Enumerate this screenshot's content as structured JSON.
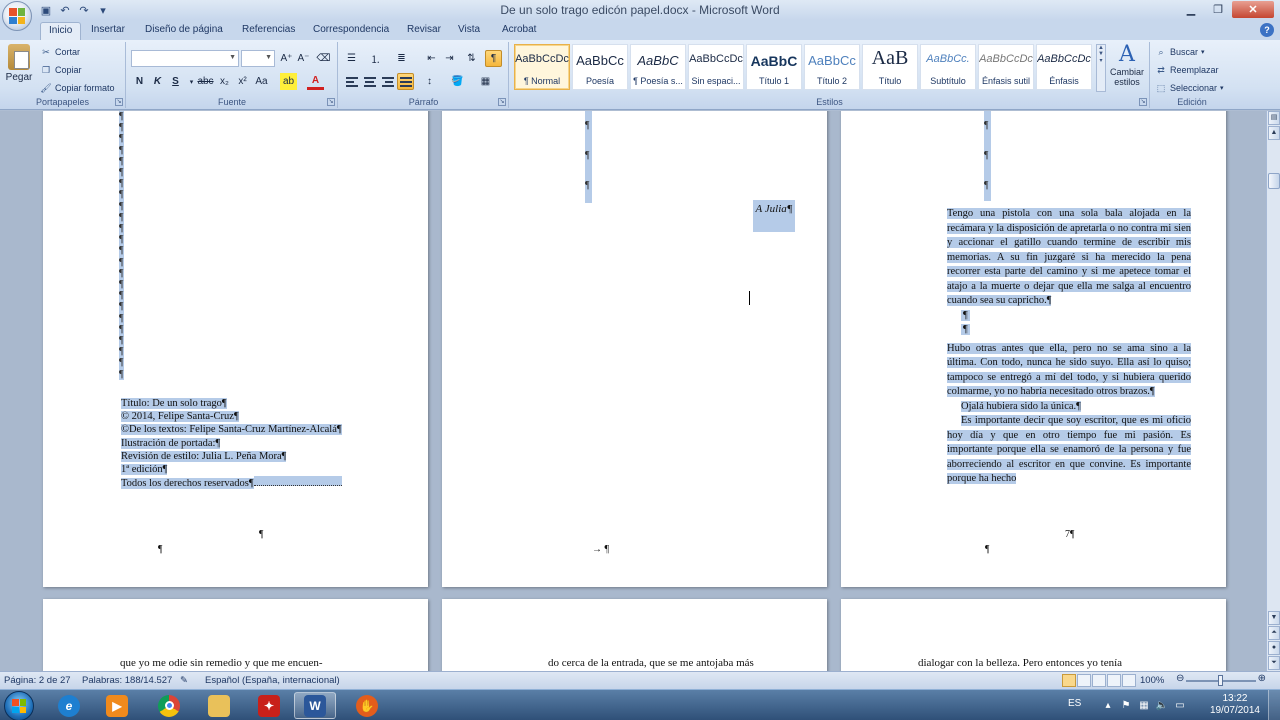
{
  "window": {
    "title": "De un solo trago edicón papel.docx - Microsoft Word"
  },
  "tabs": [
    "Inicio",
    "Insertar",
    "Diseño de página",
    "Referencias",
    "Correspondencia",
    "Revisar",
    "Vista",
    "Acrobat"
  ],
  "ribbon": {
    "clipboard": {
      "label": "Portapapeles",
      "paste": "Pegar",
      "cut": "Cortar",
      "copy": "Copiar",
      "format_painter": "Copiar formato"
    },
    "font": {
      "label": "Fuente",
      "name": "",
      "size": ""
    },
    "paragraph": {
      "label": "Párrafo"
    },
    "styles": {
      "label": "Estilos",
      "items": [
        {
          "sample": "AaBbCcDc",
          "name": "¶ Normal"
        },
        {
          "sample": "AaBbCc",
          "name": "Poesía"
        },
        {
          "sample": "AaBbC",
          "name": "¶ Poesía s..."
        },
        {
          "sample": "AaBbCcDc",
          "name": "Sin espaci..."
        },
        {
          "sample": "AaBbC",
          "name": "Título 1"
        },
        {
          "sample": "AaBbCc",
          "name": "Título 2"
        },
        {
          "sample": "AaB",
          "name": "Título"
        },
        {
          "sample": "AaBbCc.",
          "name": "Subtítulo"
        },
        {
          "sample": "AaBbCcDc",
          "name": "Énfasis sutil"
        },
        {
          "sample": "AaBbCcDc",
          "name": "Énfasis"
        }
      ],
      "change_styles": "Cambiar estilos"
    },
    "editing": {
      "label": "Edición",
      "find": "Buscar",
      "replace": "Reemplazar",
      "select": "Seleccionar"
    }
  },
  "pages": {
    "page1": {
      "copyright_lines": [
        "Título: De un solo trago¶",
        "© 2014, Felipe Santa-Cruz¶",
        "©De los textos: Felipe Santa-Cruz Martínez-Alcalá¶",
        "Ilustración de portada:¶",
        "Revisión de estilo: Julia L. Peña Mora¶",
        "1ª edición¶",
        "Todos los derechos reservados¶"
      ],
      "footer_mark": "¶",
      "bottom_mark": "¶"
    },
    "page2": {
      "dedication": "A Julia¶",
      "footer_mark": "→ ¶"
    },
    "page3": {
      "paragraphs": [
        "Tengo una pistola con una sola bala alojada en la recámara y la disposición de apretarla o no contra mi sien y accionar el gatillo cuando termine de escribir mis memorias. A su fin juzgaré si ha merecido la pena recorrer esta parte del camino y si me apetece tomar el atajo a la muerte o dejar que ella me salga al encuentro cuando sea su capricho.¶",
        "Hubo otras antes que ella, pero no se ama sino a la última. Con todo, nunca he sido suyo. Ella así lo quiso; tampoco se entregó a mí del todo, y si hubiera querido colmarme, yo no habría necesitado otros brazos.¶",
        "Ojalá hubiera sido la única.¶",
        "Es importante decir que soy escritor, que es mi oficio hoy día y que en otro tiempo fue mi pasión. Es importante porque ella se enamoró de la persona y fue aborreciendo al escritor en que convine. Es importante porque ha hecho"
      ],
      "page_number": "7¶",
      "bottom_mark": "¶"
    },
    "page4": {
      "first_line": "que yo me odie sin remedio y que me encuen-"
    },
    "page5": {
      "first_line": "do cerca de la entrada, que se me antojaba más"
    },
    "page6": {
      "first_line": "dialogar con la belleza. Pero entonces yo tenía"
    }
  },
  "status": {
    "page": "Página: 2 de 27",
    "words": "Palabras: 188/14.527",
    "language": "Español (España, internacional)",
    "zoom": "100%",
    "zoom_level": 0.5
  },
  "taskbar": {
    "lang": "ES",
    "time": "13:22",
    "date": "19/07/2014"
  },
  "colors": {
    "selection": "#b5cbe8",
    "ribbon_bg": "#d3e1f2",
    "doc_bg": "#a9b8cd"
  }
}
